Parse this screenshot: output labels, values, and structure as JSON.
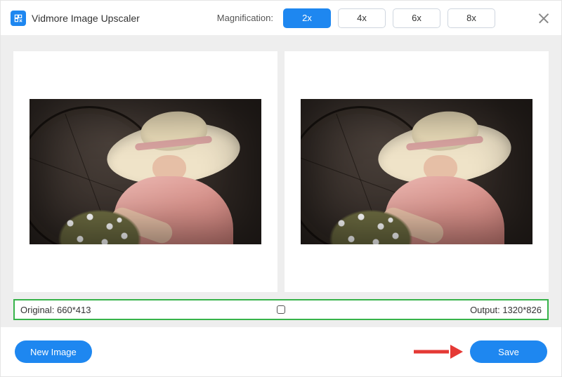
{
  "header": {
    "app_title": "Vidmore Image Upscaler",
    "magnification_label": "Magnification:",
    "options": [
      {
        "label": "2x",
        "active": true
      },
      {
        "label": "4x",
        "active": false
      },
      {
        "label": "6x",
        "active": false
      },
      {
        "label": "8x",
        "active": false
      }
    ]
  },
  "status": {
    "original_label": "Original:",
    "original_value": "660*413",
    "output_label": "Output:",
    "output_value": "1320*826"
  },
  "footer": {
    "new_image_label": "New Image",
    "save_label": "Save"
  },
  "colors": {
    "accent": "#1e87f0",
    "highlight_border": "#37b34a",
    "annotation_arrow": "#e53935"
  }
}
